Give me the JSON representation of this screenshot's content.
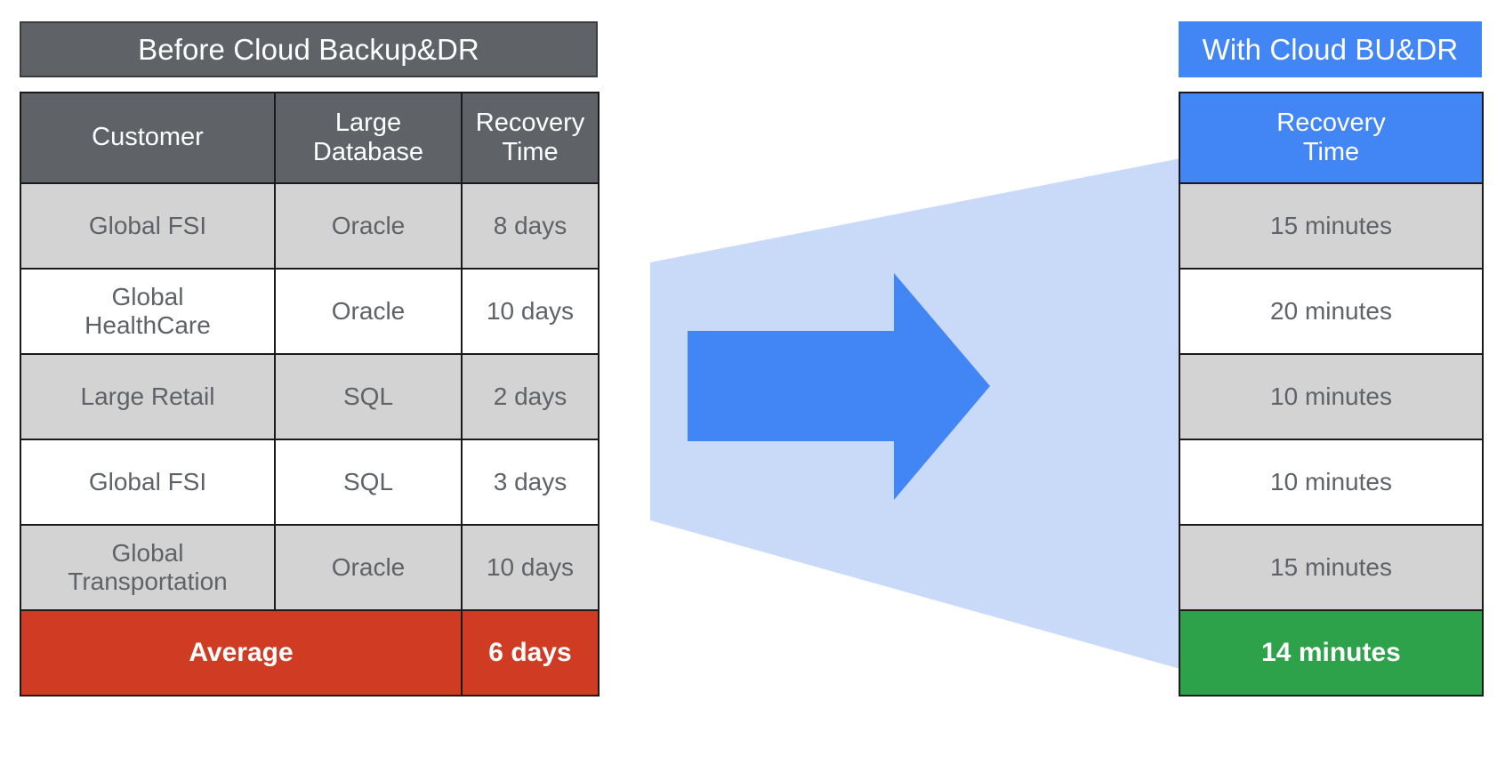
{
  "left_panel": {
    "title": "Before Cloud Backup&DR",
    "title_bg": "#5F6368",
    "columns": [
      "Customer",
      "Large\nDatabase",
      "Recovery\nTime"
    ],
    "rows": [
      {
        "customer": "Global FSI",
        "database": "Oracle",
        "recovery_time": "8 days"
      },
      {
        "customer": "Global\nHealthCare",
        "database": "Oracle",
        "recovery_time": "10 days"
      },
      {
        "customer": "Large Retail",
        "database": "SQL",
        "recovery_time": "2 days"
      },
      {
        "customer": "Global FSI",
        "database": "SQL",
        "recovery_time": "3 days"
      },
      {
        "customer": "Global\nTransportation",
        "database": "Oracle",
        "recovery_time": "10 days"
      }
    ],
    "summary": {
      "label": "Average",
      "value": "6 days",
      "bg": "#D03B23"
    }
  },
  "right_panel": {
    "title": "With Cloud BU&DR",
    "title_bg": "#4285F4",
    "columns": [
      "Recovery\nTime"
    ],
    "rows": [
      {
        "recovery_time": "15 minutes"
      },
      {
        "recovery_time": "20 minutes"
      },
      {
        "recovery_time": "10 minutes"
      },
      {
        "recovery_time": "10 minutes"
      },
      {
        "recovery_time": "15 minutes"
      }
    ],
    "summary": {
      "value": "14 minutes",
      "bg": "#2EA14B"
    }
  },
  "transition": {
    "funnel_color": "#C9DAF8",
    "arrow_color": "#4285F4",
    "arrow_icon": "right-arrow-icon"
  }
}
